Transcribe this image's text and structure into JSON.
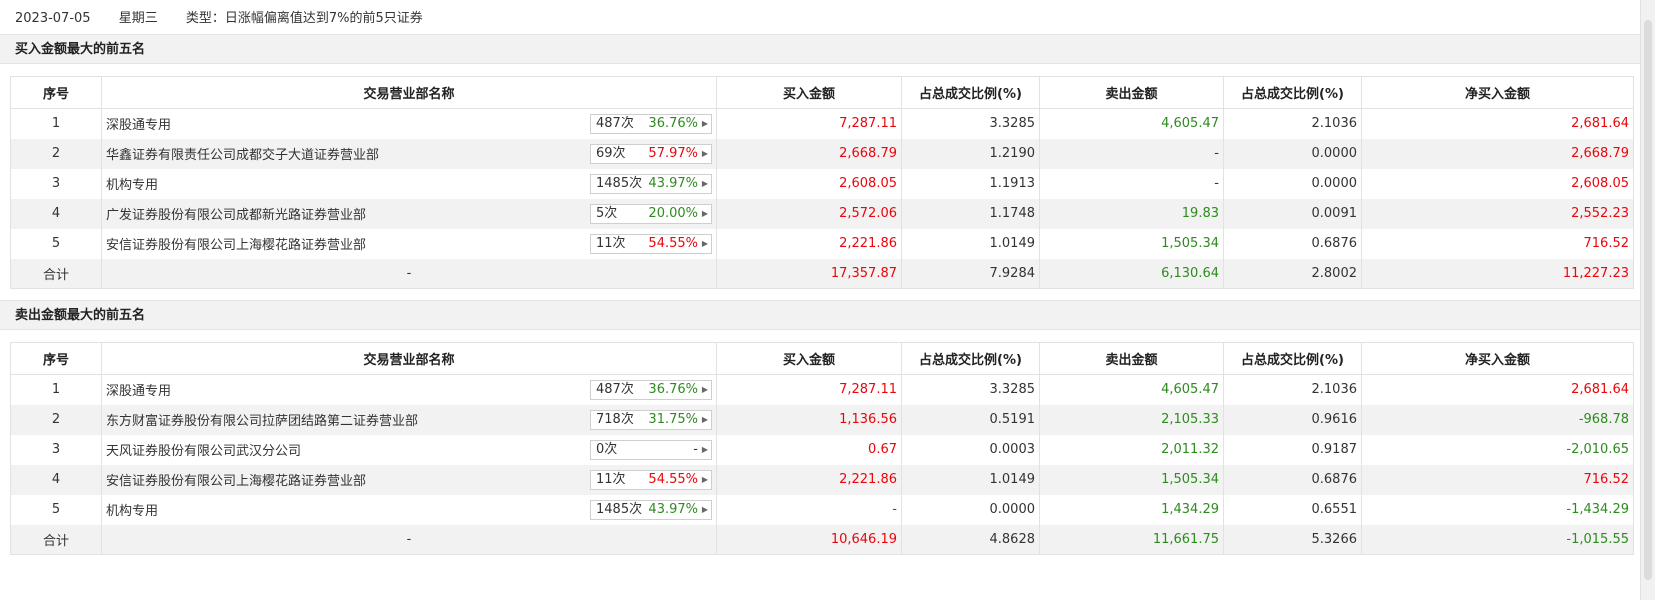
{
  "header": {
    "date": "2023-07-05",
    "weekday": "星期三",
    "type_label": "类型：日涨幅偏离值达到7%的前5只证券"
  },
  "buy_section": {
    "title": "买入金额最大的前五名",
    "columns": [
      "序号",
      "交易营业部名称",
      "买入金额",
      "占总成交比例(%)",
      "卖出金额",
      "占总成交比例(%)",
      "净买入金额"
    ],
    "rows": [
      {
        "no": "1",
        "name": "深股通专用",
        "count": "487次",
        "rate": "36.76%",
        "rate_color": "green",
        "buy": "7,287.11",
        "buy_pct": "3.3285",
        "sell": "4,605.47",
        "sell_pct": "2.1036",
        "net": "2,681.64",
        "net_color": "red",
        "buy_color": "red",
        "sell_color": "green"
      },
      {
        "no": "2",
        "name": "华鑫证券有限责任公司成都交子大道证券营业部",
        "count": "69次",
        "rate": "57.97%",
        "rate_color": "red",
        "buy": "2,668.79",
        "buy_pct": "1.2190",
        "sell": "-",
        "sell_pct": "0.0000",
        "net": "2,668.79",
        "net_color": "red",
        "buy_color": "red",
        "sell_color": "black"
      },
      {
        "no": "3",
        "name": "机构专用",
        "count": "1485次",
        "rate": "43.97%",
        "rate_color": "green",
        "buy": "2,608.05",
        "buy_pct": "1.1913",
        "sell": "-",
        "sell_pct": "0.0000",
        "net": "2,608.05",
        "net_color": "red",
        "buy_color": "red",
        "sell_color": "black"
      },
      {
        "no": "4",
        "name": "广发证券股份有限公司成都新光路证券营业部",
        "count": "5次",
        "rate": "20.00%",
        "rate_color": "green",
        "buy": "2,572.06",
        "buy_pct": "1.1748",
        "sell": "19.83",
        "sell_pct": "0.0091",
        "net": "2,552.23",
        "net_color": "red",
        "buy_color": "red",
        "sell_color": "green"
      },
      {
        "no": "5",
        "name": "安信证券股份有限公司上海樱花路证券营业部",
        "count": "11次",
        "rate": "54.55%",
        "rate_color": "red",
        "buy": "2,221.86",
        "buy_pct": "1.0149",
        "sell": "1,505.34",
        "sell_pct": "0.6876",
        "net": "716.52",
        "net_color": "red",
        "buy_color": "red",
        "sell_color": "green"
      }
    ],
    "total": {
      "label": "合计",
      "name": "-",
      "buy": "17,357.87",
      "buy_pct": "7.9284",
      "sell": "6,130.64",
      "sell_pct": "2.8002",
      "net": "11,227.23",
      "net_color": "red"
    }
  },
  "sell_section": {
    "title": "卖出金额最大的前五名",
    "columns": [
      "序号",
      "交易营业部名称",
      "买入金额",
      "占总成交比例(%)",
      "卖出金额",
      "占总成交比例(%)",
      "净买入金额"
    ],
    "rows": [
      {
        "no": "1",
        "name": "深股通专用",
        "count": "487次",
        "rate": "36.76%",
        "rate_color": "green",
        "buy": "7,287.11",
        "buy_pct": "3.3285",
        "sell": "4,605.47",
        "sell_pct": "2.1036",
        "net": "2,681.64",
        "net_color": "red",
        "buy_color": "red",
        "sell_color": "green"
      },
      {
        "no": "2",
        "name": "东方财富证券股份有限公司拉萨团结路第二证券营业部",
        "count": "718次",
        "rate": "31.75%",
        "rate_color": "green",
        "buy": "1,136.56",
        "buy_pct": "0.5191",
        "sell": "2,105.33",
        "sell_pct": "0.9616",
        "net": "-968.78",
        "net_color": "green",
        "buy_color": "red",
        "sell_color": "green"
      },
      {
        "no": "3",
        "name": "天风证券股份有限公司武汉分公司",
        "count": "0次",
        "rate": "-",
        "rate_color": "black",
        "buy": "0.67",
        "buy_pct": "0.0003",
        "sell": "2,011.32",
        "sell_pct": "0.9187",
        "net": "-2,010.65",
        "net_color": "green",
        "buy_color": "red",
        "sell_color": "green"
      },
      {
        "no": "4",
        "name": "安信证券股份有限公司上海樱花路证券营业部",
        "count": "11次",
        "rate": "54.55%",
        "rate_color": "red",
        "buy": "2,221.86",
        "buy_pct": "1.0149",
        "sell": "1,505.34",
        "sell_pct": "0.6876",
        "net": "716.52",
        "net_color": "red",
        "buy_color": "red",
        "sell_color": "green"
      },
      {
        "no": "5",
        "name": "机构专用",
        "count": "1485次",
        "rate": "43.97%",
        "rate_color": "green",
        "buy": "-",
        "buy_pct": "0.0000",
        "sell": "1,434.29",
        "sell_pct": "0.6551",
        "net": "-1,434.29",
        "net_color": "green",
        "buy_color": "red",
        "sell_color": "green"
      }
    ],
    "total": {
      "label": "合计",
      "name": "-",
      "buy": "10,646.19",
      "buy_pct": "4.8628",
      "sell": "11,661.75",
      "sell_pct": "5.3266",
      "net": "-1,015.55",
      "net_color": "green"
    }
  },
  "icons": {
    "count_arrow": "caret-right-icon"
  }
}
